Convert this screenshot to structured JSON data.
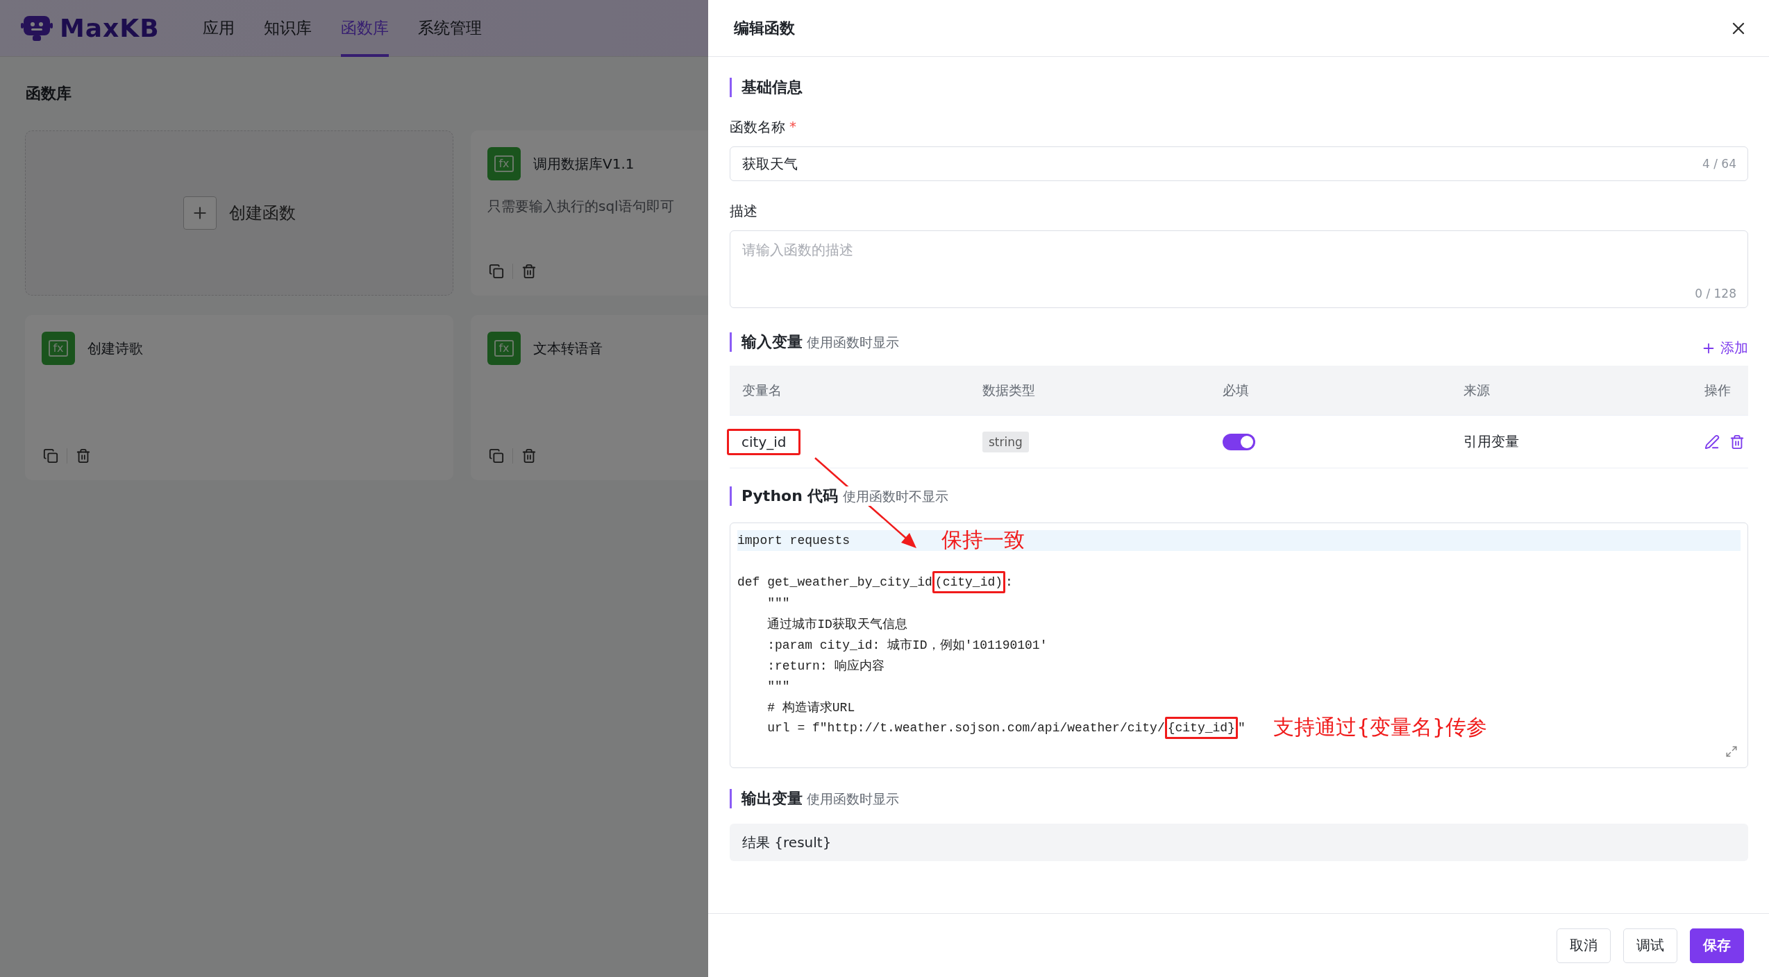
{
  "app": {
    "logo": "MaxKB",
    "nav": [
      {
        "label": "应用",
        "selected": false
      },
      {
        "label": "知识库",
        "selected": false
      },
      {
        "label": "函数库",
        "selected": true
      },
      {
        "label": "系统管理",
        "selected": false
      }
    ],
    "page_title": "函数库",
    "cards": [
      {
        "kind": "create",
        "label": "创建函数"
      },
      {
        "kind": "function",
        "icon_label": "fx",
        "name": "调用数据库V1.1",
        "description": "只需要输入执行的sql语句即可"
      },
      {
        "kind": "function",
        "icon_label": "fx",
        "name": "创建诗歌"
      },
      {
        "kind": "function",
        "icon_label": "fx",
        "name": "文本转语音"
      }
    ]
  },
  "drawer": {
    "title": "编辑函数",
    "basics": {
      "title": "基础信息",
      "name_field": {
        "label": "函数名称",
        "required": true,
        "required_mark": "*",
        "value": "获取天气",
        "counter": "4 / 64"
      },
      "desc_field": {
        "label": "描述",
        "placeholder": "请输入函数的描述",
        "counter": "0 / 128"
      }
    },
    "inputs": {
      "title": "输入变量",
      "hint": "使用函数时显示",
      "add": "添加",
      "columns": [
        "变量名",
        "数据类型",
        "必填",
        "来源",
        "操作"
      ],
      "rows": [
        {
          "name": "city_id",
          "highlighted": true,
          "type": "string",
          "required": true,
          "source": "引用变量"
        }
      ]
    },
    "code": {
      "title": "Python 代码",
      "hint": "使用函数时不显示",
      "lines": [
        {
          "kind": "code",
          "current": true,
          "segments": [
            {
              "text": "import requests",
              "highlighted": false
            }
          ],
          "note": "保持一致"
        },
        {
          "kind": "blank"
        },
        {
          "kind": "code",
          "current": false,
          "segments": [
            {
              "text": "def get_weather_by_city_id",
              "highlighted": false
            },
            {
              "text": "(city_id)",
              "highlighted": true
            },
            {
              "text": ":",
              "highlighted": false
            }
          ]
        },
        {
          "kind": "code",
          "current": false,
          "segments": [
            {
              "text": "    \"\"\"",
              "highlighted": false
            }
          ]
        },
        {
          "kind": "code",
          "current": false,
          "segments": [
            {
              "text": "    通过城市ID获取天气信息",
              "highlighted": false
            }
          ]
        },
        {
          "kind": "code",
          "current": false,
          "segments": [
            {
              "text": "    :param city_id: 城市ID，例如'101190101'",
              "highlighted": false
            }
          ]
        },
        {
          "kind": "code",
          "current": false,
          "segments": [
            {
              "text": "    :return: 响应内容",
              "highlighted": false
            }
          ]
        },
        {
          "kind": "code",
          "current": false,
          "segments": [
            {
              "text": "    \"\"\"",
              "highlighted": false
            }
          ]
        },
        {
          "kind": "code",
          "current": false,
          "segments": [
            {
              "text": "    # 构造请求URL",
              "highlighted": false
            }
          ]
        },
        {
          "kind": "code",
          "current": false,
          "segments": [
            {
              "text": "    url = f\"http://t.weather.sojson.com/api/weather/city/",
              "highlighted": false
            },
            {
              "text": "{city_id}",
              "highlighted": true
            },
            {
              "text": "\"",
              "highlighted": false
            }
          ],
          "note": "支持通过{变量名}传参"
        }
      ]
    },
    "output": {
      "title": "输出变量",
      "hint": "使用函数时显示",
      "value": "结果 {result}"
    },
    "buttons": [
      {
        "label": "取消",
        "kind": "default"
      },
      {
        "label": "调试",
        "kind": "default"
      },
      {
        "label": "保存",
        "kind": "primary"
      }
    ]
  }
}
